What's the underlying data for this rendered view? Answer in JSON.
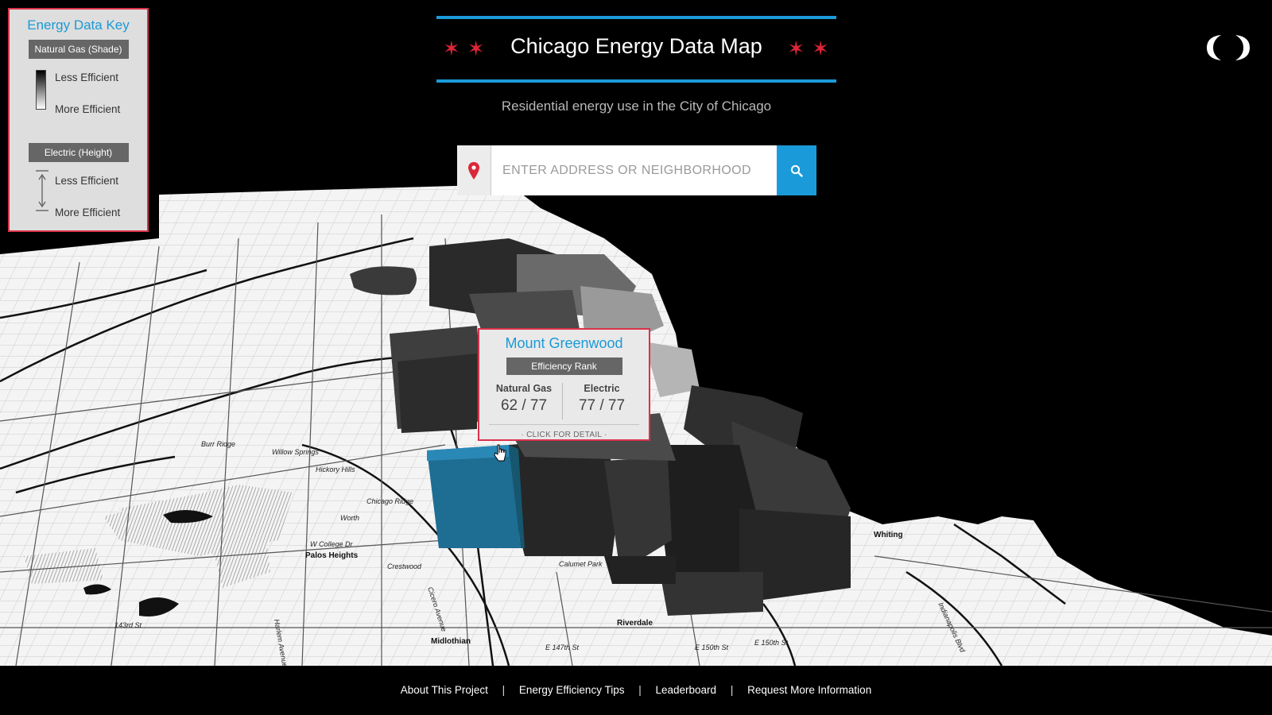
{
  "header": {
    "title": "Chicago Energy Data Map",
    "subtitle": "Residential energy use in the City of Chicago"
  },
  "search": {
    "placeholder": "ENTER ADDRESS OR NEIGHBORHOOD",
    "pin_icon": "location-pin-icon",
    "button_icon": "search-icon"
  },
  "legend": {
    "title": "Energy Data Key",
    "gas_heading": "Natural Gas (Shade)",
    "gas_less": "Less Efficient",
    "gas_more": "More Efficient",
    "electric_heading": "Electric (Height)",
    "electric_less": "Less Efficient",
    "electric_more": "More Efficient"
  },
  "popup": {
    "neighborhood": "Mount Greenwood",
    "rank_label": "Efficiency Rank",
    "gas_label": "Natural Gas",
    "gas_value": "62 / 77",
    "electric_label": "Electric",
    "electric_value": "77 / 77",
    "detail_link": "· CLICK FOR DETAIL ·"
  },
  "map_labels": {
    "riverdale": "Riverdale",
    "midlothian": "Midlothian",
    "crestwood": "Crestwood",
    "calumet_park": "Calumet Park",
    "palos_heights": "Palos Heights",
    "worth": "Worth",
    "chicago_ridge": "Chicago Ridge",
    "hickory_hills": "Hickory Hills",
    "willow_springs": "Willow Springs",
    "burr_ridge": "Burr Ridge",
    "whiting": "Whiting",
    "e_147th": "E 147th St",
    "e_150th_a": "E 150th St",
    "e_150th_b": "E 150th St",
    "w_143rd": "143rd St",
    "w_college_dr": "W College Dr",
    "indianapolis_blvd": "Indianapolis Blvd",
    "cicero": "Cicero Avenue",
    "harlem": "Harlem Avenue"
  },
  "footer": {
    "about": "About This Project",
    "tips": "Energy Efficiency Tips",
    "leaderboard": "Leaderboard",
    "request": "Request More Information",
    "separator": "|"
  },
  "colors": {
    "accent_blue": "#1b9ad9",
    "accent_red": "#d9324a",
    "star_red": "#e02535",
    "selected_region": "#1e6d93"
  }
}
